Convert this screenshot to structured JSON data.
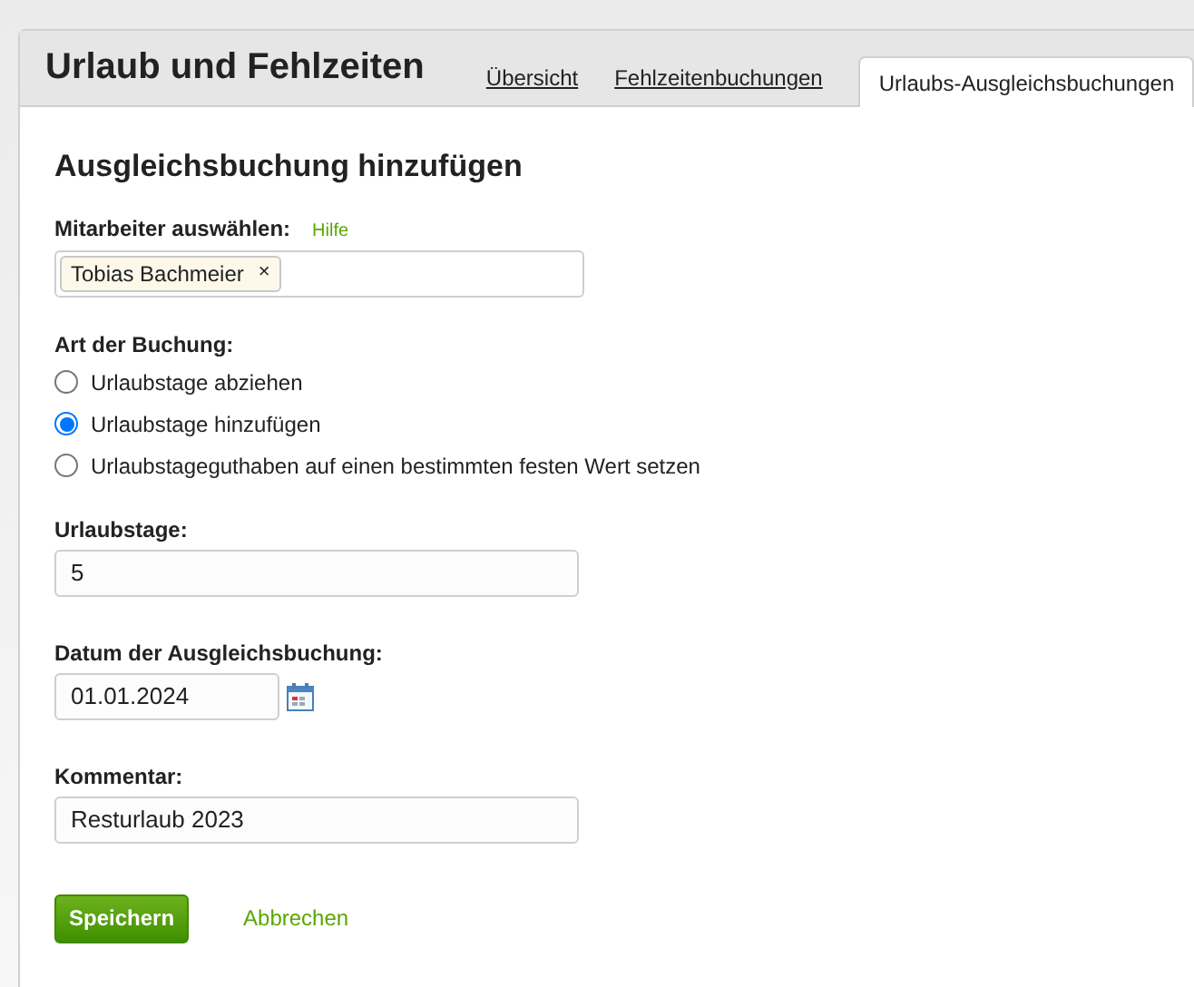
{
  "header": {
    "title": "Urlaub und Fehlzeiten"
  },
  "tabs": [
    {
      "label": "Übersicht",
      "selected": false
    },
    {
      "label": "Fehlzeitenbuchungen",
      "selected": false
    },
    {
      "label": "Urlaubs-Ausgleichsbuchungen",
      "selected": true
    }
  ],
  "form": {
    "title": "Ausgleichsbuchung hinzufügen",
    "employee": {
      "label": "Mitarbeiter auswählen:",
      "help": "Hilfe",
      "tags": [
        {
          "label": "Tobias Bachmeier",
          "remove": "×"
        }
      ]
    },
    "booking_type": {
      "label": "Art der Buchung:",
      "options": [
        {
          "label": "Urlaubstage abziehen",
          "selected": false
        },
        {
          "label": "Urlaubstage hinzufügen",
          "selected": true
        },
        {
          "label": "Urlaubstageguthaben auf einen bestimmten festen Wert setzen",
          "selected": false
        }
      ]
    },
    "days": {
      "label": "Urlaubstage:",
      "value": "5"
    },
    "date": {
      "label": "Datum der Ausgleichsbuchung:",
      "value": "01.01.2024"
    },
    "comment": {
      "label": "Kommentar:",
      "value": "Resturlaub 2023"
    },
    "save_button": "Speichern",
    "cancel_link": "Abbrechen"
  }
}
